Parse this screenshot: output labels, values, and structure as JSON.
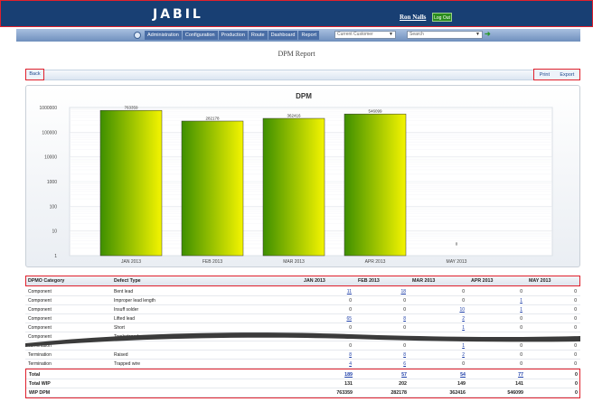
{
  "header": {
    "logo": "JABIL",
    "user": "Ron Nalls",
    "logout": "Log Out"
  },
  "nav": {
    "items": [
      "Administration",
      "Configuration",
      "Production",
      "Route",
      "Dashboard",
      "Report"
    ],
    "customer_select": "Current Customer",
    "search_select": "Search"
  },
  "page": {
    "title": "DPM Report",
    "back": "Back",
    "print": "Print",
    "export": "Export"
  },
  "chart_data": {
    "type": "bar",
    "title": "DPM",
    "categories": [
      "JAN 2013",
      "FEB 2013",
      "MAR 2013",
      "APR 2013",
      "MAY 2013"
    ],
    "values": [
      763359,
      282178,
      362416,
      546099,
      0
    ],
    "data_labels": [
      "763359",
      "282178",
      "362416",
      "546099",
      "0"
    ],
    "yscale": "log",
    "ylim": [
      1,
      1000000
    ],
    "yticks": [
      "1000000",
      "100000",
      "10000",
      "1000",
      "100",
      "10",
      "1"
    ],
    "grid": true,
    "colors": {
      "bar_dark": "#3e8f00",
      "bar_light": "#f4f400"
    }
  },
  "table": {
    "headers": [
      "DPMO Category",
      "Defect Type",
      "JAN 2013",
      "FEB 2013",
      "MAR 2013",
      "APR 2013",
      "MAY 2013"
    ],
    "rows": [
      {
        "category": "Component",
        "defect": "Bent lead",
        "jan": "11",
        "feb": "18",
        "mar": "0",
        "apr": "0",
        "may": "0"
      },
      {
        "category": "Component",
        "defect": "Improper lead length",
        "jan": "0",
        "feb": "0",
        "mar": "0",
        "apr": "1",
        "may": "0"
      },
      {
        "category": "Component",
        "defect": "Insuff solder",
        "jan": "0",
        "feb": "0",
        "mar": "10",
        "apr": "1",
        "may": "0"
      },
      {
        "category": "Component",
        "defect": "Lifted lead",
        "jan": "65",
        "feb": "8",
        "mar": "2",
        "apr": "0",
        "may": "0"
      },
      {
        "category": "Component",
        "defect": "Short",
        "jan": "0",
        "feb": "0",
        "mar": "1",
        "apr": "0",
        "may": "0"
      },
      {
        "category": "Component",
        "defect": "Tombstoned",
        "jan": "",
        "feb": "",
        "mar": "",
        "apr": "",
        "may": ""
      },
      {
        "category": "Termination",
        "defect": "",
        "jan": "0",
        "feb": "0",
        "mar": "1",
        "apr": "0",
        "may": "0"
      },
      {
        "category": "Termination",
        "defect": "Raised",
        "jan": "8",
        "feb": "8",
        "mar": "2",
        "apr": "0",
        "may": "0"
      },
      {
        "category": "Termination",
        "defect": "Trapped wire",
        "jan": "4",
        "feb": "6",
        "mar": "0",
        "apr": "0",
        "may": "0"
      }
    ],
    "totals": [
      {
        "label": "Total",
        "jan": "189",
        "feb": "57",
        "mar": "54",
        "apr": "77",
        "may": "0"
      },
      {
        "label": "Total WIP",
        "jan": "131",
        "feb": "202",
        "mar": "149",
        "apr": "141",
        "may": "0"
      },
      {
        "label": "WIP DPM",
        "jan": "763359",
        "feb": "282178",
        "mar": "362416",
        "apr": "546099",
        "may": "0"
      }
    ]
  }
}
